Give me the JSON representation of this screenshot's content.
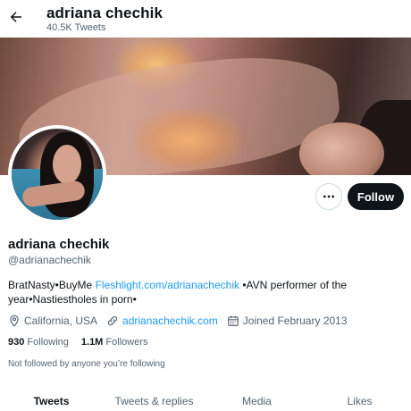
{
  "header": {
    "title": "adriana chechik",
    "tweet_count": "40.5K Tweets",
    "back_icon": "arrow-left-icon"
  },
  "banner": {
    "description_icon": "banner-image"
  },
  "avatar": {
    "icon": "profile-avatar"
  },
  "actions": {
    "more_icon": "ellipsis-icon",
    "follow_label": "Follow"
  },
  "profile": {
    "name": "adriana chechik",
    "handle": "@adrianachechik",
    "bio_prefix": "BratNasty•BuyMe ",
    "bio_link": "Fleshlight.com/adrianachechik",
    "bio_suffix": " •AVN performer of the year•Nastiestholes in porn•",
    "location": "California, USA",
    "website": "adrianachechik.com",
    "joined": "Joined February 2013"
  },
  "stats": {
    "following_count": "930",
    "following_label": "Following",
    "followers_count": "1.1M",
    "followers_label": "Followers"
  },
  "followed_note": "Not followed by anyone you’re following",
  "tabs": [
    {
      "label": "Tweets",
      "active": true
    },
    {
      "label": "Tweets & replies",
      "active": false
    },
    {
      "label": "Media",
      "active": false
    },
    {
      "label": "Likes",
      "active": false
    }
  ],
  "colors": {
    "accent": "#1d9bf0",
    "text": "#0f1419",
    "secondary": "#536471",
    "button_dark": "#0f1419"
  }
}
